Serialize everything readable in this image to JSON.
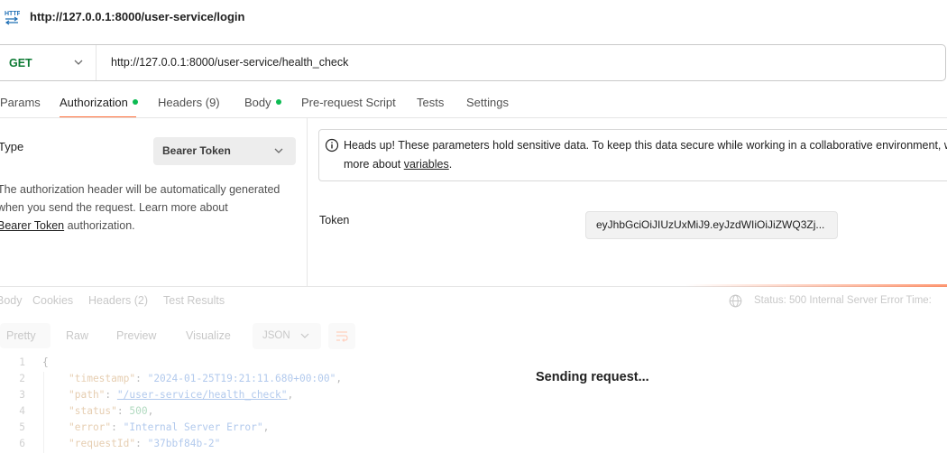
{
  "request": {
    "title": "http://127.0.0.1:8000/user-service/login",
    "method": "GET",
    "url": "http://127.0.0.1:8000/user-service/health_check"
  },
  "tabs": [
    {
      "label": "Params"
    },
    {
      "label": "Authorization"
    },
    {
      "label": "Headers (9)"
    },
    {
      "label": "Body"
    },
    {
      "label": "Pre-request Script"
    },
    {
      "label": "Tests"
    },
    {
      "label": "Settings"
    }
  ],
  "auth": {
    "type_label": "Type",
    "type_value": "Bearer Token",
    "desc_line1": "The authorization header will be automatically generated",
    "desc_line2": "when you send the request. Learn more about",
    "desc_link": "Bearer Token",
    "desc_tail": " authorization.",
    "info_text": "Heads up! These parameters hold sensitive data. To keep this data secure while working in a collaborative environment, we recommend using variables. Learn",
    "info_line2": "more about ",
    "info_link": "variables",
    "info_end": ".",
    "token_label": "Token",
    "token_value": "eyJhbGciOiJIUzUxMiJ9.eyJzdWIiOiJiZWQ3Zj..."
  },
  "response": {
    "tabs": [
      "Body",
      "Cookies",
      "Headers (2)",
      "Test Results"
    ],
    "status": "Status: 500 Internal Server Error   Time:",
    "format_buttons": [
      "Pretty",
      "Raw",
      "Preview",
      "Visualize"
    ],
    "format": "JSON",
    "sending_text": "Sending request...",
    "code": {
      "line_numbers": [
        "1",
        "2",
        "3",
        "4",
        "5",
        "6"
      ],
      "open_brace": "{",
      "timestamp_key": "\"timestamp\"",
      "timestamp_val": "\"2024-01-25T19:21:11.680+00:00\"",
      "path_key": "\"path\"",
      "path_val": "\"/user-service/health_check\"",
      "status_key": "\"status\"",
      "status_val": "500",
      "error_key": "\"error\"",
      "error_val": "\"Internal Server Error\"",
      "requestId_key": "\"requestId\"",
      "requestId_val": "\"37bbf84b-2\""
    }
  },
  "colors": {
    "accent": "#ff6c37",
    "method_get": "#0c7a33",
    "dot_green": "#0cbb52"
  },
  "icons": [
    "http-icon",
    "chevron-down-icon",
    "info-icon",
    "globe-icon",
    "wrap-lines-icon"
  ]
}
